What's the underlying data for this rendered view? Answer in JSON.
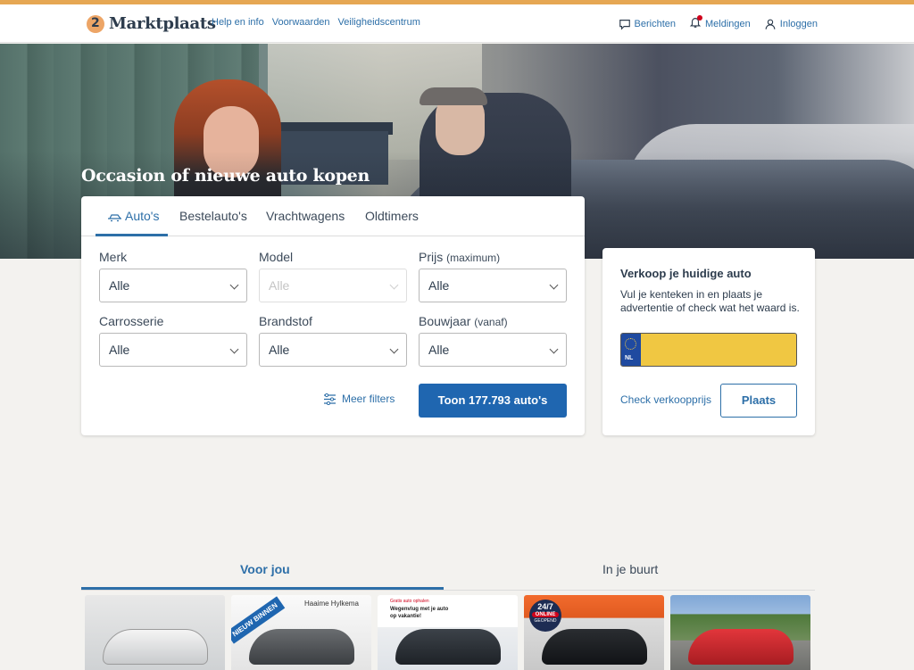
{
  "header": {
    "logo_text": "Marktplaats",
    "nav_links": [
      "Help en info",
      "Voorwaarden",
      "Veiligheidscentrum"
    ],
    "right": {
      "messages": "Berichten",
      "notifications": "Meldingen",
      "login": "Inloggen"
    }
  },
  "hero": {
    "title": "Occasion of nieuwe auto kopen"
  },
  "search": {
    "tabs": [
      "Auto's",
      "Bestelauto's",
      "Vrachtwagens",
      "Oldtimers"
    ],
    "active_tab": 0,
    "fields": {
      "merk": {
        "label": "Merk",
        "value": "Alle"
      },
      "model": {
        "label": "Model",
        "value": "Alle",
        "disabled": true
      },
      "prijs": {
        "label": "Prijs",
        "sublabel": "(maximum)",
        "value": "Alle"
      },
      "carrosserie": {
        "label": "Carrosserie",
        "value": "Alle"
      },
      "brandstof": {
        "label": "Brandstof",
        "value": "Alle"
      },
      "bouwjaar": {
        "label": "Bouwjaar",
        "sublabel": "(vanaf)",
        "value": "Alle"
      }
    },
    "more_filters": "Meer filters",
    "submit": "Toon 177.793 auto's"
  },
  "sell": {
    "title": "Verkoop je huidige auto",
    "text": "Vul je kenteken in en plaats je advertentie of check wat het waard is.",
    "plate_country": "NL",
    "check_link": "Check verkoopprijs",
    "place_button": "Plaats"
  },
  "feed": {
    "tabs": [
      "Voor jou",
      "In je buurt"
    ],
    "active_tab": 0,
    "cards": [
      {
        "badge": "",
        "dealer": ""
      },
      {
        "badge": "NIEUW BINNEN",
        "dealer": "Haaime Hylkema"
      },
      {
        "promo_top": "Gratis auto ophalen",
        "promo": "Wegenvlug met je auto op vakantie!"
      },
      {
        "badge_line1": "24/7",
        "badge_line2": "ONLINE",
        "badge_line3": "GEOPEND"
      },
      {
        "badge": ""
      }
    ]
  },
  "colors": {
    "accent_stripe": "#e6a753",
    "primary_blue": "#1f66b0",
    "link_blue": "#2d6fa8",
    "plate_yellow": "#f0c742",
    "page_bg": "#f3f2ef"
  }
}
